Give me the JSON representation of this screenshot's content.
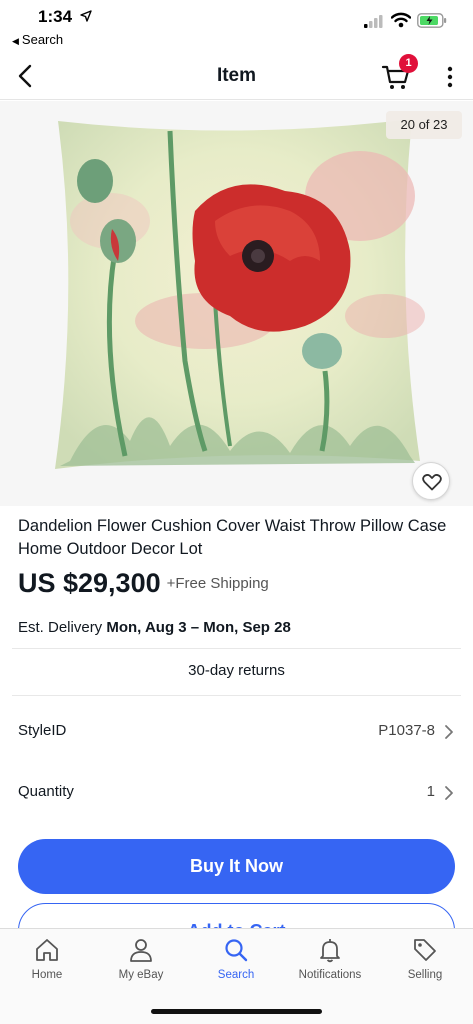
{
  "status_bar": {
    "time": "1:34",
    "back_app_label": "Search"
  },
  "header": {
    "title": "Item",
    "cart_count": "1"
  },
  "image": {
    "counter": "20 of 23"
  },
  "product": {
    "title": "Dandelion Flower Cushion Cover Waist Throw Pillow Case Home Outdoor Decor Lot",
    "price": "US $29,300",
    "shipping": "+Free Shipping",
    "delivery_label": "Est. Delivery",
    "delivery_dates": "Mon, Aug 3 – Mon, Sep 28",
    "returns": "30-day returns"
  },
  "options": {
    "style_label": "StyleID",
    "style_value": "P1037-8",
    "quantity_label": "Quantity",
    "quantity_value": "1"
  },
  "actions": {
    "buy_now": "Buy It Now",
    "add_to_cart": "Add to Cart"
  },
  "tabs": [
    {
      "label": "Home",
      "icon": "home-icon"
    },
    {
      "label": "My eBay",
      "icon": "person-icon"
    },
    {
      "label": "Search",
      "icon": "search-icon"
    },
    {
      "label": "Notifications",
      "icon": "bell-icon"
    },
    {
      "label": "Selling",
      "icon": "tag-icon"
    }
  ],
  "colors": {
    "accent": "#3665f3",
    "badge": "#e0103a",
    "text": "#111820"
  }
}
